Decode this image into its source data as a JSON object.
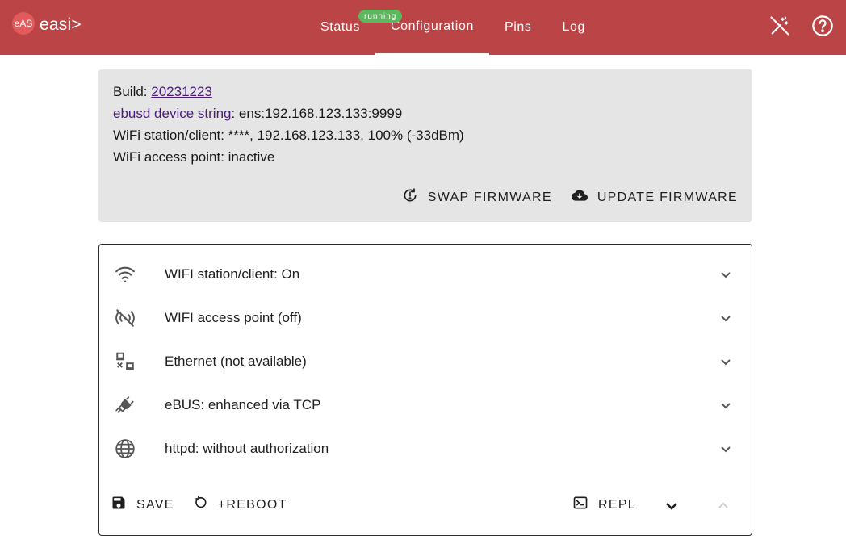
{
  "header": {
    "logo_text": "eAS",
    "brand": "easi>",
    "tabs": [
      {
        "label": "Status"
      },
      {
        "label": "Configuration"
      },
      {
        "label": "Pins"
      },
      {
        "label": "Log"
      }
    ],
    "status_badge": "running",
    "active_tab": "Configuration",
    "icons": [
      "wand-off-icon",
      "help-circle-icon"
    ]
  },
  "info": {
    "build_label": "Build: ",
    "build_value": "20231223",
    "device_link": "ebusd device string",
    "device_value": ": ens:192.168.123.133:9999",
    "wifi_station": "WiFi station/client: ****, 192.168.123.133, 100% (-33dBm)",
    "wifi_ap": "WiFi access point: inactive",
    "swap_label": "SWAP FIRMWARE",
    "update_label": "UPDATE FIRMWARE"
  },
  "config": {
    "items": [
      {
        "label": "WIFI station/client: On",
        "icon": "wifi-icon"
      },
      {
        "label": "WIFI access point (off)",
        "icon": "wifi-ap-off-icon"
      },
      {
        "label": "Ethernet (not available)",
        "icon": "lan-disconnect-icon"
      },
      {
        "label": "eBUS: enhanced via TCP",
        "icon": "plug-icon"
      },
      {
        "label": "httpd: without authorization",
        "icon": "globe-icon"
      }
    ],
    "save_label": "SAVE",
    "reboot_label": "+REBOOT",
    "repl_label": "REPL"
  },
  "colors": {
    "header_bg": "#bb4446",
    "badge_bg": "#5cb85c",
    "card_bg": "#e5e5e5",
    "link": "#4b1c7a"
  }
}
